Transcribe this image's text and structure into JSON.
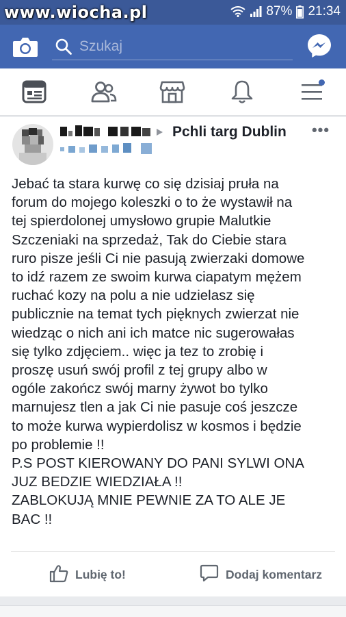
{
  "watermark": "www.wiocha.pl",
  "status": {
    "battery": "87%",
    "time": "21:34"
  },
  "header": {
    "search_placeholder": "Szukaj"
  },
  "nav": {
    "icons": [
      "news-feed-icon",
      "friends-icon",
      "marketplace-icon",
      "notifications-icon",
      "menu-icon"
    ]
  },
  "post": {
    "group_name": "Pchli targ Dublin",
    "more_label": "•••",
    "text": "Jebać ta stara kurwę co się dzisiaj pruła na\nforum do mojego koleszki o to że wystawił na\ntej spierdolonej umysłowo grupie Malutkie\nSzczeniaki na sprzedaż, Tak do Ciebie stara\nruro pisze jeśli Ci nie pasują zwierzaki domowe\nto idź razem ze swoim kurwa ciapatym mężem\nruchać kozy na polu a nie udzielasz się\npublicznie na temat tych pięknych zwierzat nie\nwiedząc o nich ani ich matce nic sugerowałas\nsię tylko zdjęciem.. więc ja tez to zrobię i\nproszę usuń swój profil z tej grupy albo w\nogóle zakończ swój marny żywot bo tylko\nmarnujesz tlen a jak Ci nie pasuje coś jeszcze\nto może kurwa wypierdolisz w kosmos i będzie\npo problemie !!\nP.S POST KIEROWANY DO PANI SYLWI ONA\nJUZ BEDZIE WIEDZIAŁA !!\nZABLOKUJĄ MNIE PEWNIE ZA TO ALE JE\nBAC !!"
  },
  "actions": {
    "like_label": "Lubię to!",
    "comment_label": "Dodaj komentarz"
  },
  "colors": {
    "brand": "#4267b2",
    "status_bar": "#3b5998",
    "text": "#1d2129",
    "muted": "#606770"
  }
}
